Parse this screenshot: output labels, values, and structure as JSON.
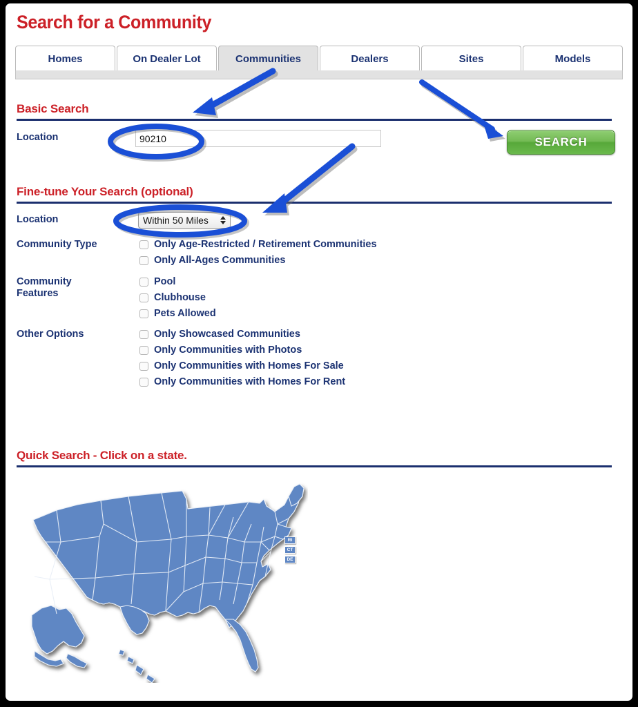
{
  "page": {
    "title": "Search for a Community"
  },
  "tabs": [
    {
      "label": "Homes",
      "active": false
    },
    {
      "label": "On Dealer Lot",
      "active": false
    },
    {
      "label": "Communities",
      "active": true
    },
    {
      "label": "Dealers",
      "active": false
    },
    {
      "label": "Sites",
      "active": false
    },
    {
      "label": "Models",
      "active": false
    }
  ],
  "basic_search": {
    "heading": "Basic Search",
    "location_label": "Location",
    "location_value": "90210",
    "location_placeholder": "",
    "search_button": "SEARCH"
  },
  "fine_tune": {
    "heading": "Fine-tune Your Search (optional)",
    "location_label": "Location",
    "distance_selected": "Within 50 Miles",
    "distance_options": [
      "Within 50 Miles"
    ],
    "groups": [
      {
        "label": "Community Type",
        "options": [
          {
            "label": "Only Age-Restricted / Retirement Communities",
            "checked": false
          },
          {
            "label": "Only All-Ages Communities",
            "checked": false
          }
        ]
      },
      {
        "label": "Community\nFeatures",
        "options": [
          {
            "label": "Pool",
            "checked": false
          },
          {
            "label": "Clubhouse",
            "checked": false
          },
          {
            "label": "Pets Allowed",
            "checked": false
          }
        ]
      },
      {
        "label": "Other Options",
        "options": [
          {
            "label": "Only Showcased Communities",
            "checked": false
          },
          {
            "label": "Only Communities with Photos",
            "checked": false
          },
          {
            "label": "Only Communities with Homes For Sale",
            "checked": false
          },
          {
            "label": "Only Communities with Homes For Rent",
            "checked": false
          }
        ]
      }
    ]
  },
  "quick_search": {
    "heading": "Quick Search - Click on a state.",
    "map_name": "united-states-map",
    "small_state_labels": [
      "RI",
      "CT",
      "DE"
    ]
  },
  "colors": {
    "heading_red": "#cc2027",
    "label_blue": "#1b3272",
    "rule_navy": "#1b2f6e",
    "map_blue": "#5f87c4",
    "button_green": "#6ab94c",
    "annotation_blue": "#1a4fd6",
    "tab_active_gray": "#e2e2e2"
  },
  "annotations": {
    "arrow_to_tab": "arrow-pointing-to-communities-tab",
    "arrow_to_search_button": "arrow-pointing-to-search-button",
    "arrow_to_distance_select": "arrow-pointing-to-distance-select",
    "ellipse_location_input": "highlight-ellipse-location-input",
    "ellipse_distance_select": "highlight-ellipse-distance-select"
  }
}
